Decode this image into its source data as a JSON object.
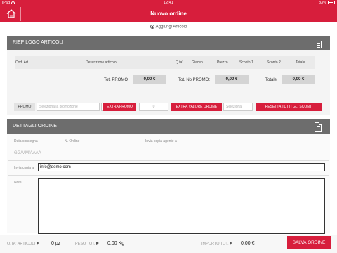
{
  "status_bar": {
    "device": "iPad",
    "time": "12:41",
    "battery": "83%"
  },
  "nav": {
    "title": "Nuovo ordine",
    "home_icon": "home-icon"
  },
  "add_article": {
    "label": "Aggiungi Articolo",
    "icon": "add-circle-icon"
  },
  "riepilogo": {
    "title": "RIEPILOGO ARTICOLI",
    "columns": [
      "Cod. Art.",
      "Descrizione articolo",
      "Q.ta'",
      "Giacen.",
      "Prezzo",
      "Sconto 1",
      "Sconto 2",
      "Totale"
    ],
    "tot_promo_label": "Tot. PROMO",
    "tot_promo_value": "0,00 €",
    "tot_no_promo_label": "Tot. No PROMO:",
    "tot_no_promo_value": "0,00 €",
    "totale_label": "Totale",
    "totale_value": "0,00 €"
  },
  "promo_row": {
    "promo_label": "PROMO",
    "promo_placeholder": "Seleziona la promozione",
    "arrow": ">",
    "extra_promo": "EXTRA PROMO",
    "extra_promo_value": "0",
    "extra_valore": "EXTRA VALORE ORDINE",
    "extra_valore_placeholder": "Seleziona",
    "reset": "RESETTA TUTTI GLI SCONTI"
  },
  "dettagli": {
    "title": "DETTAGLI ORDINE",
    "data_consegna_label": "Data consegna",
    "data_consegna_placeholder": "GG/MM/AAAA",
    "n_ordine_label": "N. Ordine",
    "n_ordine_value": "-",
    "invia_agente_label": "Invia copia agente a",
    "invia_agente_value": "-",
    "invia_copia_label": "Invia copia a",
    "invia_copia_value": "info@demo.com",
    "note_label": "Note"
  },
  "bottom": {
    "qta_label": "Q.TA' ARTICOLI",
    "qta_value": "0 pz",
    "peso_label": "PESO TOT.",
    "peso_value": "0,00 Kg",
    "importo_label": "IMPORTO TOT.",
    "importo_value": "0,00 €",
    "save": "SALVA ORDINE"
  },
  "colors": {
    "accent": "#d71e3c",
    "header_gray": "#6d6d6d"
  }
}
